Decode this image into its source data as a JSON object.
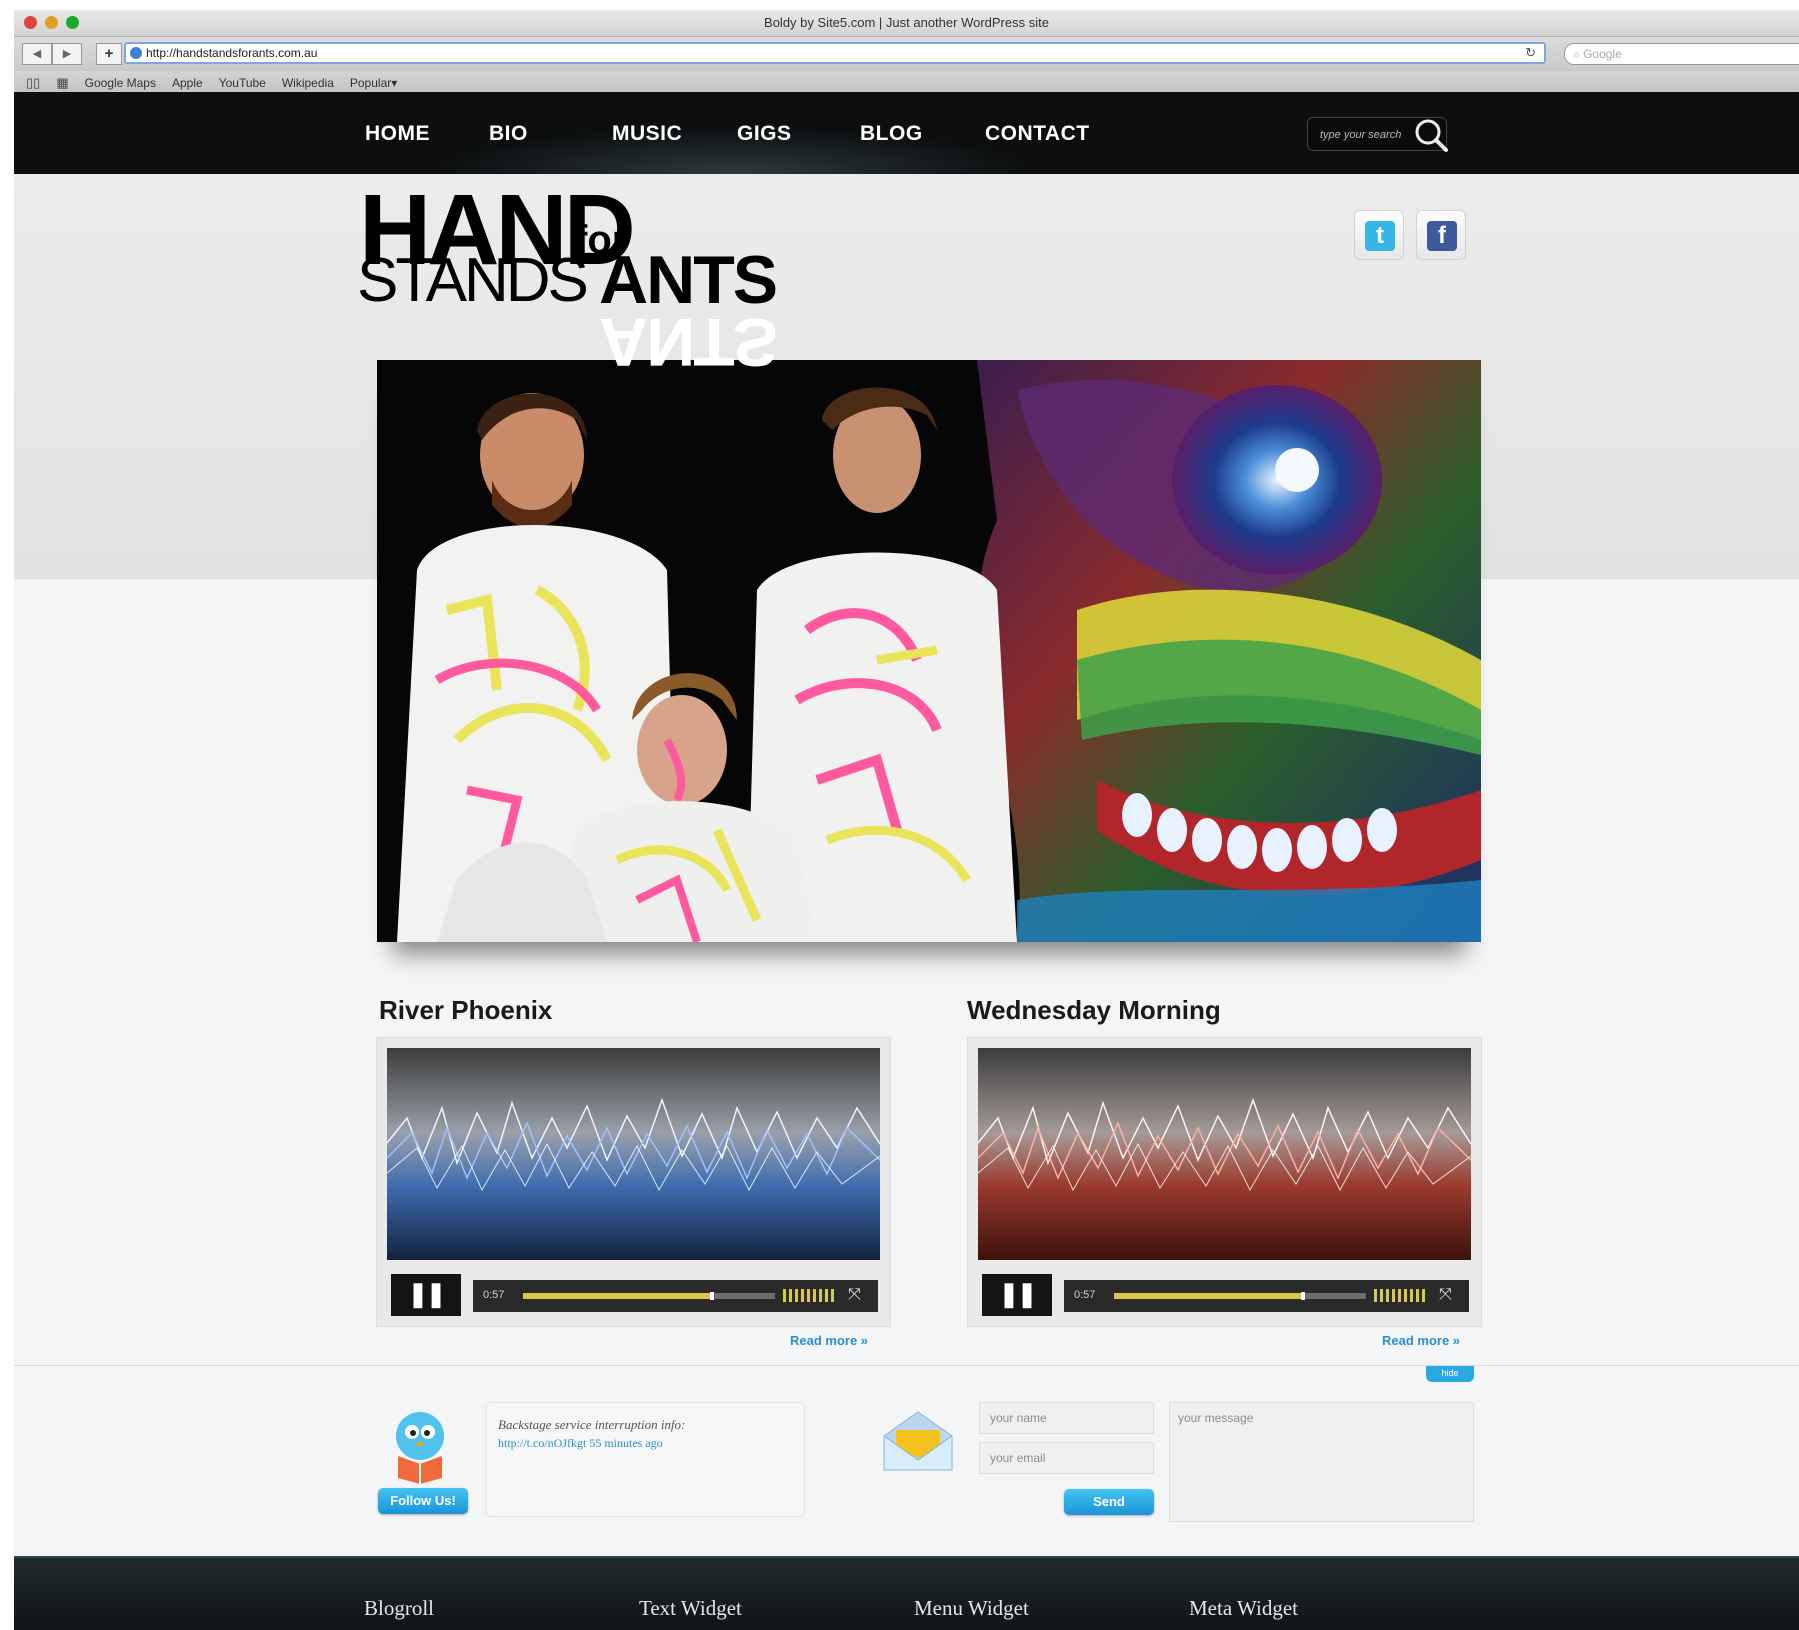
{
  "browser": {
    "window_title": "Boldy by Site5.com | Just another WordPress site",
    "url": "http://handstandsforants.com.au",
    "search_placeholder": "Google",
    "bookmarks": [
      "Google Maps",
      "Apple",
      "YouTube",
      "Wikipedia",
      "Popular"
    ]
  },
  "nav": {
    "items": [
      "HOME",
      "BIO",
      "MUSIC",
      "GIGS",
      "BLOG",
      "CONTACT"
    ],
    "search_placeholder": "type your search"
  },
  "logo": {
    "line1": "HAND",
    "small": "for",
    "line2a": "STANDS",
    "line2b": "ANTS",
    "mirrored": "ANTS"
  },
  "social": [
    {
      "name": "twitter",
      "glyph": "t",
      "color": "#35b6e6"
    },
    {
      "name": "facebook",
      "glyph": "f",
      "color": "#3b5b9c"
    }
  ],
  "tracks": [
    {
      "title": "River Phoenix",
      "time": "0:57",
      "progress": 0.75,
      "theme": "blue",
      "read_more": "Read more »"
    },
    {
      "title": "Wednesday Morning",
      "time": "0:57",
      "progress": 0.75,
      "theme": "red",
      "read_more": "Read more »"
    }
  ],
  "tab_label": "hide",
  "twitter": {
    "follow_label": "Follow Us!",
    "tweet_text": "Backstage service interruption info:",
    "tweet_link": "http://t.co/nOJfkgt 55 minutes ago"
  },
  "contact": {
    "name_placeholder": "your name",
    "email_placeholder": "your email",
    "message_placeholder": "your message",
    "send_label": "Send"
  },
  "footer": {
    "widgets": [
      "Blogroll",
      "Text Widget",
      "Menu Widget",
      "Meta Widget"
    ]
  },
  "colors": {
    "accent": "#2aa8e4",
    "nav_bg": "#0c0e0f",
    "footer_bg": "#1f2c2f",
    "progress": "#d7c93a"
  }
}
